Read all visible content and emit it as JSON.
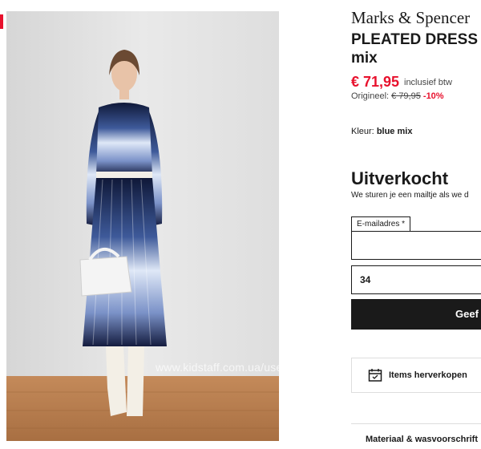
{
  "product": {
    "brand": "Marks & Spencer",
    "title_line1": "PLEATED DRESS",
    "title_line2": "mix",
    "price": "€ 71,95",
    "vat_note": "inclusief btw",
    "original_label": "Origineel:",
    "original_price": "€ 79,95",
    "discount": "-10%",
    "color_label": "Kleur:",
    "color_value": "blue mix"
  },
  "stock": {
    "status": "Uitverkocht",
    "notify_text": "We sturen je een mailtje als we d"
  },
  "form": {
    "email_label": "E-mailadres *",
    "email_value": "",
    "size_value": "34",
    "submit_label": "Geef"
  },
  "actions": {
    "reorder_label": "Items herverkopen",
    "material_label": "Materiaal & wasvoorschrift"
  },
  "watermark": "www.kidstaff.com.ua/user-159220.html",
  "colors": {
    "accent": "#e8112d",
    "dark": "#1a1a1a"
  },
  "icons": {
    "reorder": "calendar-icon"
  }
}
